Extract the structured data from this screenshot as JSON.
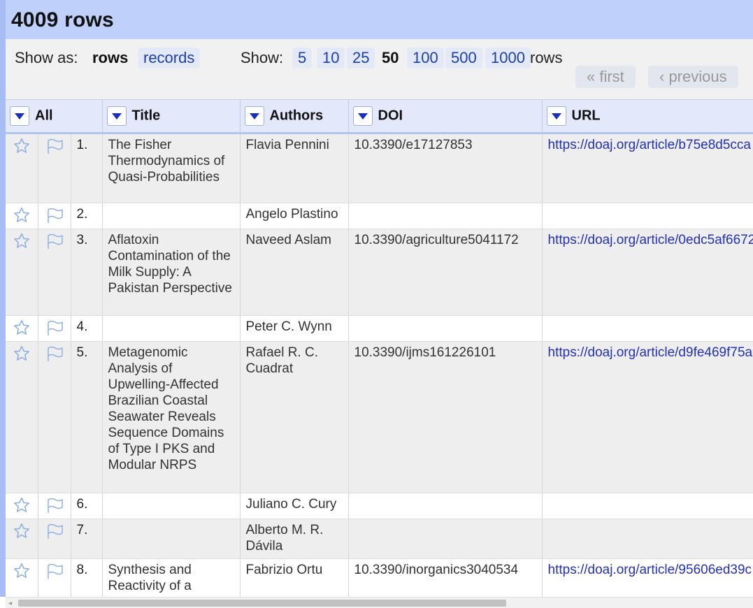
{
  "header": {
    "title": "4009 rows"
  },
  "viewbar": {
    "show_as_label": "Show as:",
    "rows_label": "rows",
    "records_label": "records",
    "show_label": "Show:",
    "page_sizes": [
      "5",
      "10",
      "25",
      "50",
      "100",
      "500",
      "1000"
    ],
    "selected_page_size": "50",
    "rows_suffix": "rows",
    "first_label": "« first",
    "previous_label": "‹ previous"
  },
  "columns": {
    "all": "All",
    "title": "Title",
    "authors": "Authors",
    "doi": "DOI",
    "url": "URL"
  },
  "icons": {
    "star": "star-icon",
    "flag": "flag-icon",
    "dropdown": "dropdown-arrow-icon"
  },
  "colors": {
    "header_bg": "#bfd0fb",
    "link": "#2331b8",
    "dropdown_arrow": "#1a2fbf"
  },
  "rows": [
    {
      "index": "1.",
      "title": "The Fisher Thermodynamics of Quasi-Probabilities",
      "authors": "Flavia Pennini",
      "doi": "10.3390/e17127853",
      "url": "https://doaj.org/article/b75e8d5cca"
    },
    {
      "index": "2.",
      "title": "",
      "authors": "Angelo Plastino",
      "doi": "",
      "url": ""
    },
    {
      "index": "3.",
      "title": "Aflatoxin Contamination of the Milk Supply: A Pakistan Perspective",
      "authors": "Naveed Aslam",
      "doi": "10.3390/agriculture5041172",
      "url": "https://doaj.org/article/0edc5af6672"
    },
    {
      "index": "4.",
      "title": "",
      "authors": "Peter C. Wynn",
      "doi": "",
      "url": ""
    },
    {
      "index": "5.",
      "title": "Metagenomic Analysis of Upwelling-Affected Brazilian Coastal Seawater Reveals Sequence Domains of Type I PKS and Modular NRPS",
      "authors": "Rafael R. C. Cuadrat",
      "doi": "10.3390/ijms161226101",
      "url": "https://doaj.org/article/d9fe469f75a"
    },
    {
      "index": "6.",
      "title": "",
      "authors": "Juliano C. Cury",
      "doi": "",
      "url": ""
    },
    {
      "index": "7.",
      "title": "",
      "authors": "Alberto M. R. Dávila",
      "doi": "",
      "url": ""
    },
    {
      "index": "8.",
      "title": "Synthesis and Reactivity of a",
      "authors": "Fabrizio Ortu",
      "doi": "10.3390/inorganics3040534",
      "url": "https://doaj.org/article/95606ed39c"
    }
  ]
}
